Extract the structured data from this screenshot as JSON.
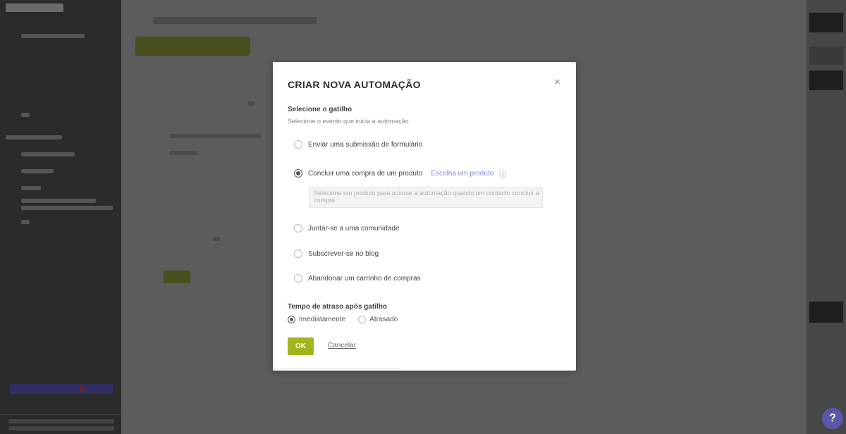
{
  "modal": {
    "title": "CRIAR NOVA AUTOMAÇÃO",
    "close_icon": "×",
    "trigger_section": {
      "label": "Selecione o gatilho",
      "hint": "Selecione o evento que inicia a automação"
    },
    "triggers": [
      {
        "label": "Enviar uma submissão de formulário",
        "checked": false
      },
      {
        "label": "Concluir uma compra de um produto",
        "link": "Escolha um produto",
        "info_icon": "ⓘ",
        "checked": true
      },
      {
        "label": "Juntar-se a uma comunidade",
        "checked": false
      },
      {
        "label": "Subscrever-se no blog",
        "checked": false
      },
      {
        "label": "Abandonar um carrinho de compras",
        "checked": false
      }
    ],
    "product_select": {
      "placeholder": "Selecione um produto para acionar a automação quando um contacto concluir a compra"
    },
    "retention": {
      "label": "Tempo de atraso após gatilho",
      "options": [
        {
          "label": "Imediatamente",
          "checked": true
        },
        {
          "label": "Atrasado",
          "checked": false
        }
      ]
    },
    "ok_label": "OK",
    "cancel_label": "Cancelar"
  },
  "help_label": "?",
  "colors": {
    "accent": "#a2b51c",
    "link": "#8a8ad0",
    "help": "#5a56a8",
    "sidebar": "#2b2b2b"
  }
}
